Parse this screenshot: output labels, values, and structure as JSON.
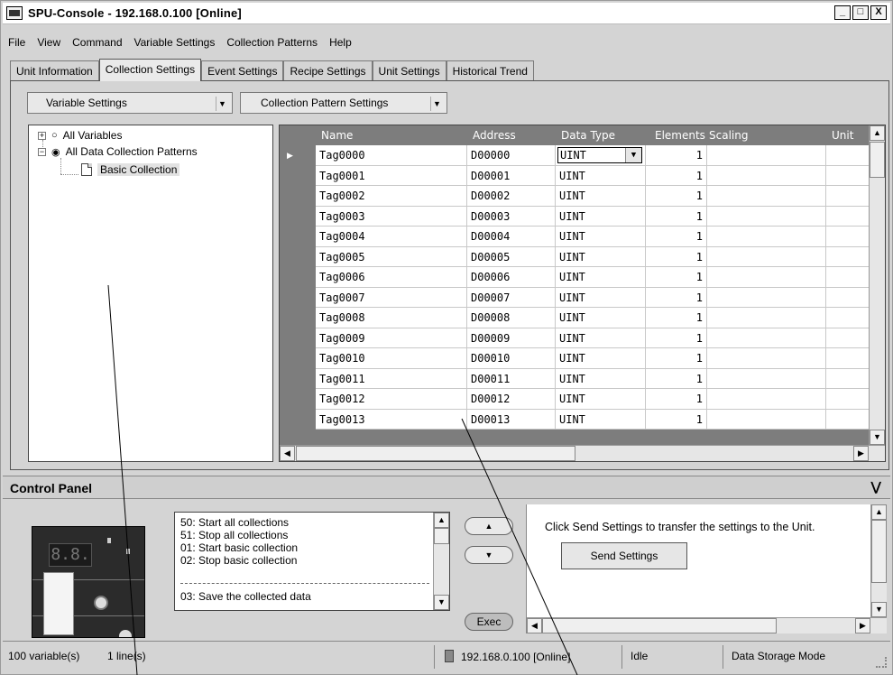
{
  "window": {
    "title": "SPU-Console - 192.168.0.100 [Online]",
    "minimize": "_",
    "maximize": "□",
    "close": "X"
  },
  "menu": [
    "File",
    "View",
    "Command",
    "Variable Settings",
    "Collection Patterns",
    "Help"
  ],
  "tabs": [
    "Unit Information",
    "Collection Settings",
    "Event Settings",
    "Recipe Settings",
    "Unit Settings",
    "Historical Trend"
  ],
  "active_tab": "Collection Settings",
  "subbar": {
    "variable_settings": "Variable Settings",
    "pattern_settings": "Collection Pattern Settings"
  },
  "tree": {
    "all_variables": "All Variables",
    "all_patterns": "All Data Collection Patterns",
    "basic_collection": "Basic Collection"
  },
  "grid": {
    "headers": [
      "Name",
      "Address",
      "Data Type",
      "Elements",
      "Scaling",
      "Unit"
    ],
    "rows": [
      {
        "name": "Tag0000",
        "address": "D00000",
        "type": "UINT",
        "elements": "1"
      },
      {
        "name": "Tag0001",
        "address": "D00001",
        "type": "UINT",
        "elements": "1"
      },
      {
        "name": "Tag0002",
        "address": "D00002",
        "type": "UINT",
        "elements": "1"
      },
      {
        "name": "Tag0003",
        "address": "D00003",
        "type": "UINT",
        "elements": "1"
      },
      {
        "name": "Tag0004",
        "address": "D00004",
        "type": "UINT",
        "elements": "1"
      },
      {
        "name": "Tag0005",
        "address": "D00005",
        "type": "UINT",
        "elements": "1"
      },
      {
        "name": "Tag0006",
        "address": "D00006",
        "type": "UINT",
        "elements": "1"
      },
      {
        "name": "Tag0007",
        "address": "D00007",
        "type": "UINT",
        "elements": "1"
      },
      {
        "name": "Tag0008",
        "address": "D00008",
        "type": "UINT",
        "elements": "1"
      },
      {
        "name": "Tag0009",
        "address": "D00009",
        "type": "UINT",
        "elements": "1"
      },
      {
        "name": "Tag0010",
        "address": "D00010",
        "type": "UINT",
        "elements": "1"
      },
      {
        "name": "Tag0011",
        "address": "D00011",
        "type": "UINT",
        "elements": "1"
      },
      {
        "name": "Tag0012",
        "address": "D00012",
        "type": "UINT",
        "elements": "1"
      },
      {
        "name": "Tag0013",
        "address": "D00013",
        "type": "UINT",
        "elements": "1"
      }
    ]
  },
  "control_panel": {
    "title": "Control Panel",
    "device_display": "8.8.",
    "commands": [
      "50: Start all collections",
      "51: Stop all collections",
      "01: Start basic collection",
      "02: Stop basic collection",
      "03: Save the collected data"
    ],
    "up_label": "▲",
    "down_label": "▼",
    "exec_label": "Exec",
    "send_message": "Click Send Settings to transfer the settings to the Unit.",
    "send_button": "Send Settings"
  },
  "status": {
    "variables": "100 variable(s)",
    "lines": "1 line(s)",
    "connection": "192.168.0.100 [Online]",
    "state": "Idle",
    "mode": "Data Storage Mode"
  }
}
